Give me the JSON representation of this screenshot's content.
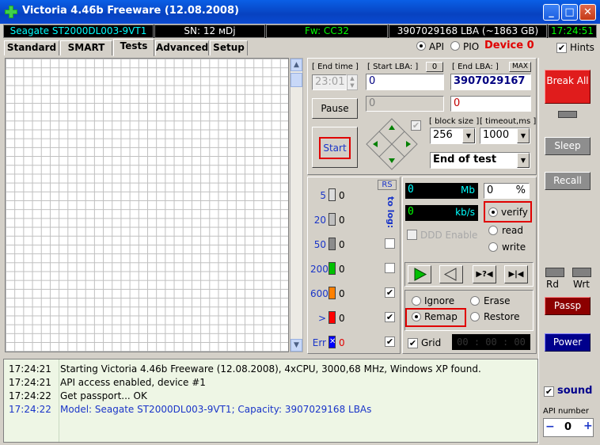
{
  "window": {
    "title": "Victoria 4.46b Freeware (12.08.2008)",
    "minimize": "_",
    "maximize": "□",
    "close": "✕"
  },
  "status_bar": {
    "model": "Seagate ST2000DL003-9VT1",
    "serial": "SN: 12   мDj",
    "firmware": "Fw: CC32",
    "lba": "3907029168 LBA (~1863 GB)",
    "clock": "17:24:51"
  },
  "tabs": [
    "Standard",
    "SMART",
    "Tests",
    "Advanced",
    "Setup"
  ],
  "selected_tab": "Tests",
  "mode": {
    "api_label": "API",
    "pio_label": "PIO",
    "selected": "API",
    "device_label": "Device 0",
    "hints_label": "Hints",
    "hints_checked": true
  },
  "test_params": {
    "end_time_label": "[ End time ]",
    "end_time_value": "23:01",
    "start_lba_label": "[ Start LBA: ]",
    "start_lba_zero": "0",
    "start_lba_value": "0",
    "end_lba_label": "[ End LBA: ]",
    "end_lba_max": "MAX",
    "end_lba_value": "3907029167",
    "current_lba": "0",
    "current_red": "0",
    "pause_label": "Pause",
    "start_label": "Start",
    "block_size_label": "[ block size ]",
    "block_size_value": "256",
    "timeout_label": "[ timeout,ms ]",
    "timeout_value": "1000",
    "end_action_value": "End of test"
  },
  "block_stats": {
    "rs_label": "RS",
    "to_log_label": "to log:",
    "rows": [
      {
        "label": "5",
        "count": "0",
        "color": "#dcdcdc",
        "to_log": false,
        "has_checkbox": false
      },
      {
        "label": "20",
        "count": "0",
        "color": "#bfbfbf",
        "to_log": false,
        "has_checkbox": false
      },
      {
        "label": "50",
        "count": "0",
        "color": "#8c8c8c",
        "to_log": false,
        "has_checkbox": true
      },
      {
        "label": "200",
        "count": "0",
        "color": "#00c000",
        "to_log": false,
        "has_checkbox": true
      },
      {
        "label": "600",
        "count": "0",
        "color": "#ff8000",
        "to_log": true,
        "has_checkbox": true
      },
      {
        "label": ">",
        "count": "0",
        "color": "#ff0000",
        "to_log": true,
        "has_checkbox": true
      },
      {
        "label": "Err",
        "count": "0",
        "color": "#0000ff",
        "err_mark": "✕",
        "to_log": true,
        "has_checkbox": true
      }
    ]
  },
  "progress": {
    "mb_value": "0",
    "mb_unit": "Mb",
    "percent_value": "0",
    "percent_unit": "%",
    "speed_value": "0",
    "speed_unit": "kb/s",
    "ddd_label": "DDD Enable",
    "ddd_checked": false
  },
  "scan_mode": {
    "options": [
      "verify",
      "read",
      "write"
    ],
    "selected": "verify"
  },
  "action_mode": {
    "options": [
      "Ignore",
      "Erase",
      "Remap",
      "Restore"
    ],
    "selected": "Remap"
  },
  "grid_option": {
    "label": "Grid",
    "checked": true
  },
  "timer": "00 : 00 : 00",
  "right_panel": {
    "break_label": "Break All",
    "sleep_label": "Sleep",
    "recall_label": "Recall",
    "rd_label": "Rd",
    "wrt_label": "Wrt",
    "passp_label": "Passp",
    "power_label": "Power",
    "sound_label": "sound",
    "sound_checked": true,
    "api_number_label": "API number",
    "api_number_value": "0",
    "api_minus": "−",
    "api_plus": "+"
  },
  "log": [
    {
      "time": "17:24:21",
      "message": "Starting Victoria 4.46b Freeware (12.08.2008), 4xCPU, 3000,68 MHz, Windows XP found.",
      "color": "#000000"
    },
    {
      "time": "17:24:21",
      "message": "API access enabled, device #1",
      "color": "#000000"
    },
    {
      "time": "17:24:22",
      "message": "Get passport... OK",
      "color": "#000000"
    },
    {
      "time": "17:24:22",
      "message": "Model: Seagate ST2000DL003-9VT1; Capacity: 3907029168 LBAs",
      "color": "#1a35c8"
    }
  ]
}
